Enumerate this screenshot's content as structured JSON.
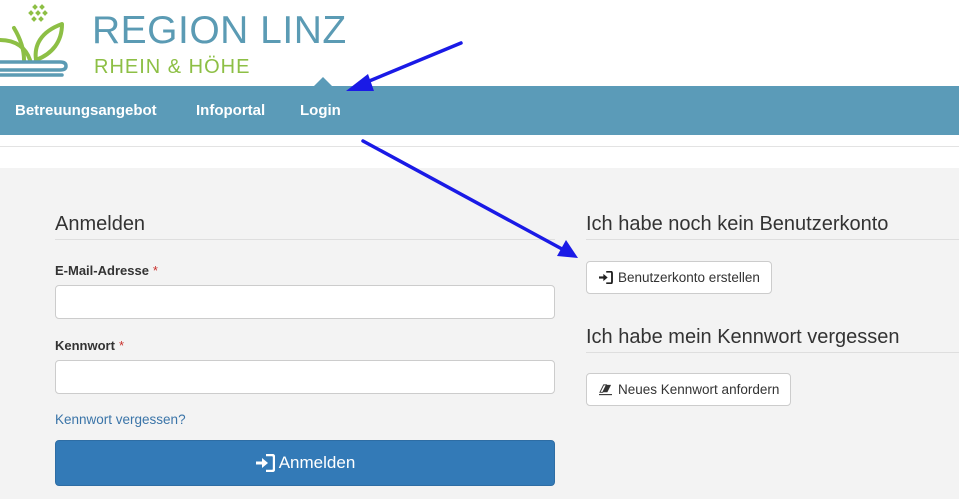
{
  "logo": {
    "title": "REGION LINZ",
    "subtitle": "RHEIN & HÖHE"
  },
  "nav": {
    "items": [
      {
        "label": "Betreuungsangebot"
      },
      {
        "label": "Infoportal"
      },
      {
        "label": "Login"
      }
    ]
  },
  "login": {
    "heading": "Anmelden",
    "email_label": "E-Mail-Adresse",
    "password_label": "Kennwort",
    "required_mark": "*",
    "email_value": "",
    "password_value": "",
    "forgot_link": "Kennwort vergessen?",
    "submit_label": "Anmelden"
  },
  "register": {
    "heading": "Ich habe noch kein Benutzerkonto",
    "button_label": "Benutzerkonto erstellen"
  },
  "reset": {
    "heading": "Ich habe mein Kennwort vergessen",
    "button_label": "Neues Kennwort anfordern"
  },
  "colors": {
    "brand_blue": "#5b9bb4",
    "brand_green": "#8dbf45",
    "nav_bg": "#5b9bb8",
    "primary_button": "#337ab7",
    "annotation_arrow": "#1a1ae6"
  },
  "icons": [
    "logo-plant-icon",
    "sign-in-icon",
    "eraser-icon",
    "annotation-arrow"
  ]
}
